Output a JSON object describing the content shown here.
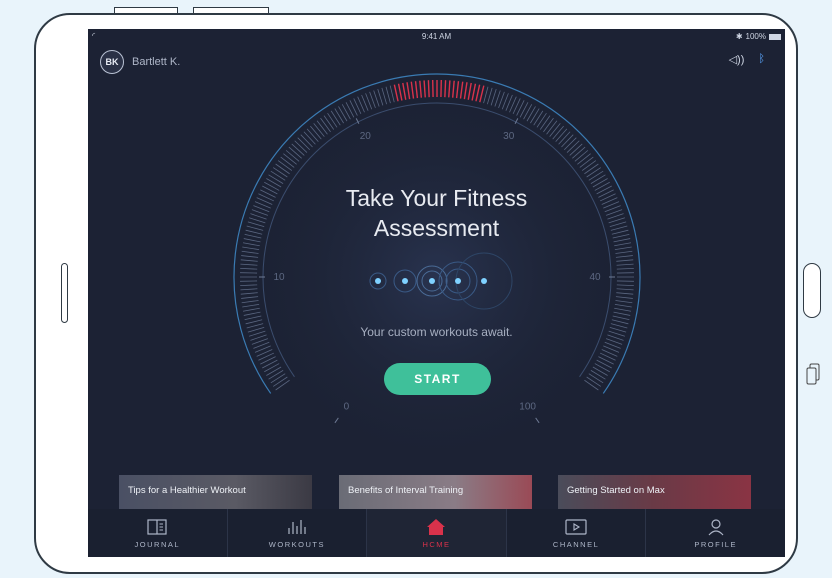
{
  "status": {
    "time": "9:41 AM",
    "battery": "100%"
  },
  "user": {
    "initials": "BK",
    "name": "Bartlett K."
  },
  "gauge": {
    "labels": [
      "0",
      "10",
      "20",
      "30",
      "40",
      "100"
    ]
  },
  "main": {
    "title_line1": "Take Your Fitness",
    "title_line2": "Assessment",
    "subtitle": "Your custom workouts await.",
    "start_label": "START"
  },
  "cards": [
    {
      "label": "Tips for a Healthier Workout"
    },
    {
      "label": "Benefits of Interval Training"
    },
    {
      "label": "Getting Started on Max"
    }
  ],
  "tabs": [
    {
      "label": "JOURNAL",
      "icon": "journal-icon"
    },
    {
      "label": "WORKOUTS",
      "icon": "workouts-icon"
    },
    {
      "label": "HCME",
      "icon": "home-icon",
      "active": true
    },
    {
      "label": "CHANNEL",
      "icon": "channel-icon"
    },
    {
      "label": "PROFILE",
      "icon": "profile-icon"
    }
  ],
  "colors": {
    "accent": "#3fc09a",
    "active": "#d9324b",
    "background": "#1c2234",
    "gauge_blue": "#3a7bb3"
  }
}
